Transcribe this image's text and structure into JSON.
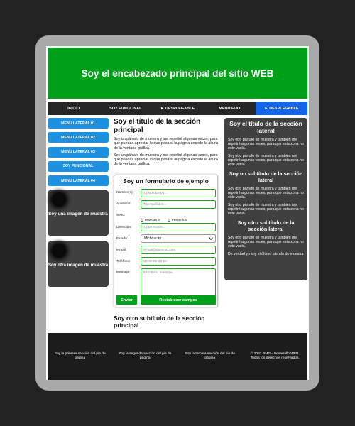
{
  "header": {
    "title": "Soy el encabezado principal del sitio WEB"
  },
  "nav": [
    {
      "label": "INICIO",
      "active": false
    },
    {
      "label": "SOY FUNCIONAL",
      "active": false
    },
    {
      "label": "► DESPLEGABLE",
      "active": false
    },
    {
      "label": "MENU FIJO",
      "active": false
    },
    {
      "label": "► DESPLEGABLE",
      "active": true
    }
  ],
  "sidebar_left": {
    "buttons": [
      "MENU LATERAL 01",
      "MENU LATERAL 02",
      "MENU LATERAL 03",
      "SOY FUNCIONAL",
      "MENU LATERAL 04"
    ],
    "image1_caption": "Soy una imagen de muestra",
    "image2_caption": "Soy otra imagen de muestra"
  },
  "main": {
    "title": "Soy el título de la sección principal",
    "paragraph1": "Soy un párrafo de muestra y me repetiré algunas veces, para que puedas apreciar lo que pasa si la página excede la altura de la ventana gráfica.",
    "paragraph2": "Soy un párrafo de muestra y me repetiré algunas veces, para que puedas apreciar lo que pasa si la página excede la altura de la ventana gráfica.",
    "subtitle2": "Soy otro subtítulo de la sección principal"
  },
  "form": {
    "title": "Soy un formulario de ejemplo",
    "name_label": "Nombre(s):",
    "name_placeholder": "Tu Nombre(s)...",
    "surname_label": "Apellidos:",
    "surname_placeholder": "Tus Apellidos...",
    "sex_label": "Sexo:",
    "sex_options": [
      "Masculino",
      "Femenino"
    ],
    "address_label": "Dirección:",
    "address_placeholder": "Tu Dirección...",
    "state_label": "Estado:",
    "state_value": "Michoacán",
    "email_label": "e-mail:",
    "email_placeholder": "e-mail@dominio.com",
    "phone_label": "Teléfono:",
    "phone_placeholder": "00-00-00-00-00",
    "message_label": "Mensaje:",
    "message_placeholder": "Escribe tu mensaje...",
    "submit_label": "Enviar",
    "reset_label": "Restablecer campos"
  },
  "sidebar_right": {
    "title": "Soy el título de la sección lateral",
    "p1": "Soy otro párrafo de muestra y también me repetiré algunas veces, para que esta zona no este vacía.",
    "p2": "Soy otro párrafo de muestra y también me repetiré algunas veces, para que esta zona no este vacía.",
    "subtitle1": "Soy un subtítulo de la sección lateral",
    "p3": "Soy otro párrafo de muestra y también me repetiré algunas veces, para que esta zona no este vacía.",
    "p4": "Soy otro párrafo de muestra y también me repetiré algunas veces, para que esta zona no este vacía.",
    "subtitle2": "Soy otro subtítulo de la sección lateral",
    "p5": "Soy otro párrafo de muestra y también me repetiré algunas veces, para que esta zona no este vacía.",
    "p6": "De verdad yo soy el último párrafo de muestra"
  },
  "footer": [
    "Soy la primera sección del pie de página",
    "Soy la segunda sección del pie de página",
    "Soy la tercera sección del pie de página",
    "© 2022 RMG - Desarrollo WEB. Todos los derechos reservados."
  ],
  "colors": {
    "header_green": "#00a01a",
    "nav_active": "#1565e8",
    "side_button": "#1e90e0",
    "dark_panel": "#404040"
  }
}
